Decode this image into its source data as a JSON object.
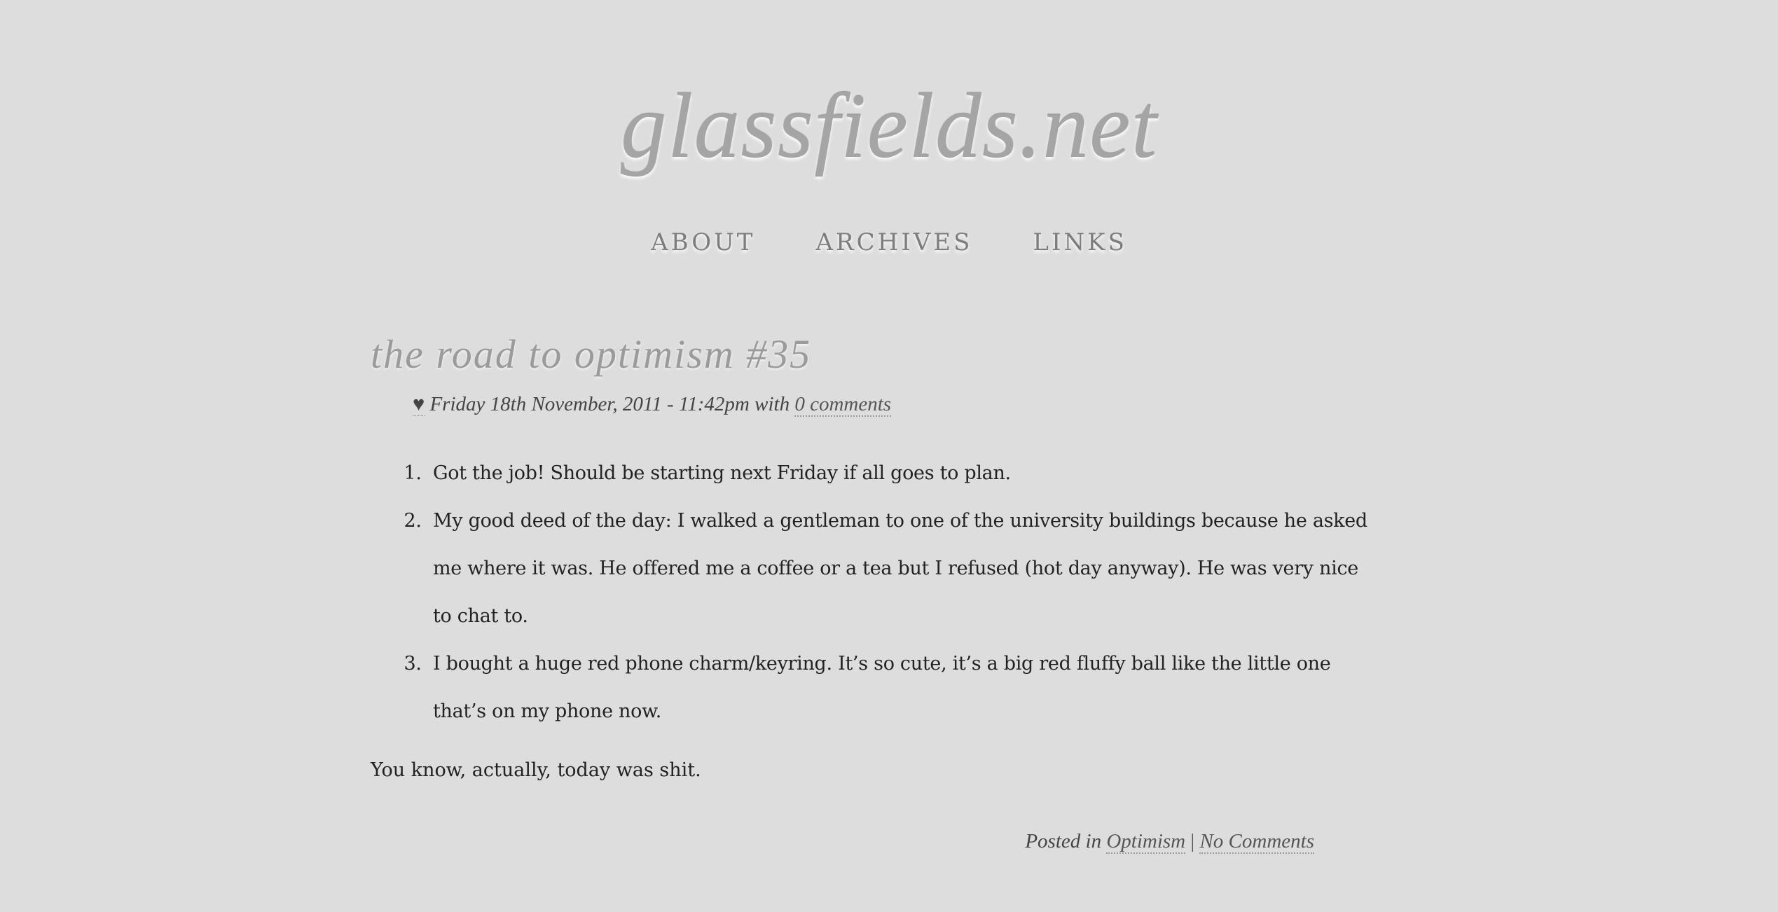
{
  "site": {
    "title": "glassfields.net"
  },
  "nav": {
    "items": [
      "ABOUT",
      "ARCHIVES",
      "LINKS"
    ]
  },
  "post": {
    "title": "the road to optimism #35",
    "meta": {
      "heart": "♥",
      "date": " Friday 18th November, 2011 - 11:42pm with ",
      "comments_link": "0 comments"
    },
    "items": [
      "Got the job! Should be starting next Friday if all goes to plan.",
      "My good deed of the day: I walked a gentleman to one of the university buildings because he asked me where it was. He offered me a coffee or a tea but I refused (hot day anyway). He was very nice to chat to.",
      "I bought a huge red phone charm/keyring. It’s so cute, it’s a big red fluffy ball like the little one that’s on my phone now."
    ],
    "closing": "You know, actually, today was shit.",
    "footer": {
      "posted_in": "Posted in ",
      "category": "Optimism",
      "separator": " | ",
      "comments": "No Comments"
    }
  }
}
